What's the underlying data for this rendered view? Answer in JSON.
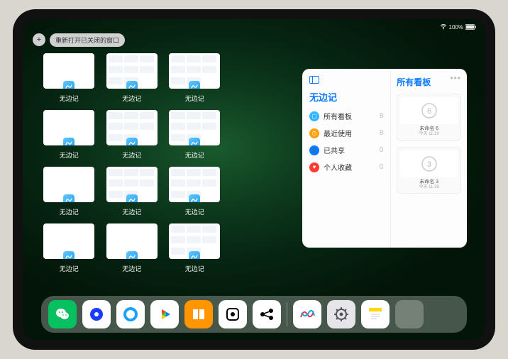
{
  "status": {
    "battery": "100%"
  },
  "actions": {
    "add": "+",
    "reopen": "重新打开已关闭的窗口"
  },
  "thumbnails": [
    {
      "label": "无边记",
      "variant": "blank"
    },
    {
      "label": "无边记",
      "variant": "app"
    },
    {
      "label": "无边记",
      "variant": "app"
    },
    {
      "label": "无边记",
      "variant": "blank"
    },
    {
      "label": "无边记",
      "variant": "app"
    },
    {
      "label": "无边记",
      "variant": "app"
    },
    {
      "label": "无边记",
      "variant": "blank"
    },
    {
      "label": "无边记",
      "variant": "app"
    },
    {
      "label": "无边记",
      "variant": "app"
    },
    {
      "label": "无边记",
      "variant": "blank"
    },
    {
      "label": "无边记",
      "variant": "blank"
    },
    {
      "label": "无边记",
      "variant": "app"
    }
  ],
  "panel": {
    "left_title": "无边记",
    "right_title": "所有看板",
    "items": [
      {
        "icon": "square",
        "color": "#2fb6ff",
        "label": "所有看板",
        "count": "8"
      },
      {
        "icon": "clock",
        "color": "#ff9f0a",
        "label": "最近使用",
        "count": "8"
      },
      {
        "icon": "people",
        "color": "#0a7aff",
        "label": "已共享",
        "count": "0"
      },
      {
        "icon": "heart",
        "color": "#ff3b30",
        "label": "个人收藏",
        "count": "0"
      }
    ],
    "boards": [
      {
        "number": "6",
        "title": "未命名 6",
        "sub": "今天 11:29"
      },
      {
        "number": "3",
        "title": "未命名 3",
        "sub": "今天 11:28"
      }
    ]
  },
  "dock": [
    {
      "name": "wechat",
      "bg": "#07c160",
      "glyph": "wechat"
    },
    {
      "name": "browser1",
      "bg": "#ffffff",
      "glyph": "circle-blue"
    },
    {
      "name": "qqbrowser",
      "bg": "#ffffff",
      "glyph": "ring-blue"
    },
    {
      "name": "play",
      "bg": "#ffffff",
      "glyph": "play"
    },
    {
      "name": "books",
      "bg": "#ff9500",
      "glyph": "books"
    },
    {
      "name": "dice",
      "bg": "#ffffff",
      "glyph": "dice"
    },
    {
      "name": "nodes",
      "bg": "#ffffff",
      "glyph": "nodes"
    },
    {
      "name": "sep"
    },
    {
      "name": "freeform",
      "bg": "#ffffff",
      "glyph": "scribble"
    },
    {
      "name": "settings",
      "bg": "#e5e5ea",
      "glyph": "gear"
    },
    {
      "name": "notes",
      "bg": "#ffffff",
      "glyph": "notes"
    },
    {
      "name": "folder",
      "bg": "folder",
      "glyph": "folder"
    }
  ]
}
